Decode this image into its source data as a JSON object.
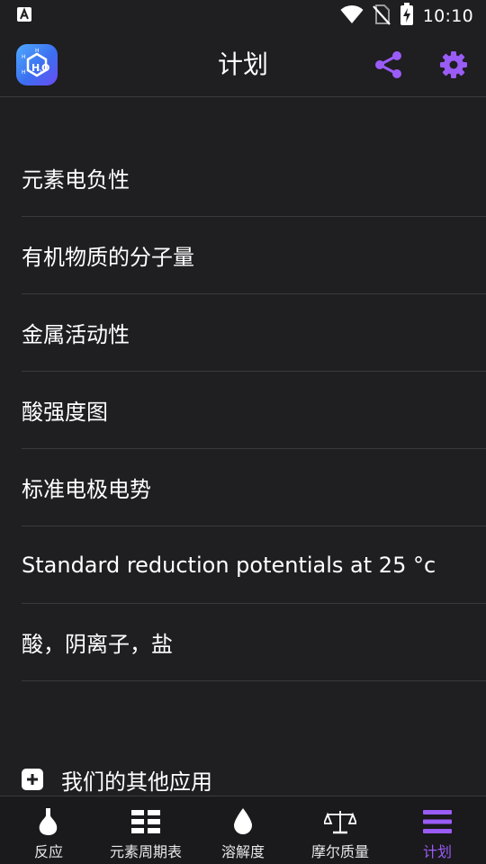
{
  "status_bar": {
    "time": "10:10"
  },
  "app_bar": {
    "title": "计划"
  },
  "list_items": [
    {
      "label": "元素电负性"
    },
    {
      "label": "有机物质的分子量"
    },
    {
      "label": "金属活动性"
    },
    {
      "label": "酸强度图"
    },
    {
      "label": "标准电极电势"
    },
    {
      "label": "Standard reduction potentials at 25 °c"
    },
    {
      "label": "酸，阴离子，盐"
    }
  ],
  "other_apps": {
    "label": "我们的其他应用"
  },
  "bottom_nav": [
    {
      "label": "反应",
      "icon": "flask-icon"
    },
    {
      "label": "元素周期表",
      "icon": "table-icon"
    },
    {
      "label": "溶解度",
      "icon": "drop-icon"
    },
    {
      "label": "摩尔质量",
      "icon": "scale-icon"
    },
    {
      "label": "计划",
      "icon": "menu-icon",
      "active": true
    }
  ],
  "colors": {
    "accent": "#9a5cf6",
    "background": "#1f1e21",
    "divider": "#3a393d"
  }
}
